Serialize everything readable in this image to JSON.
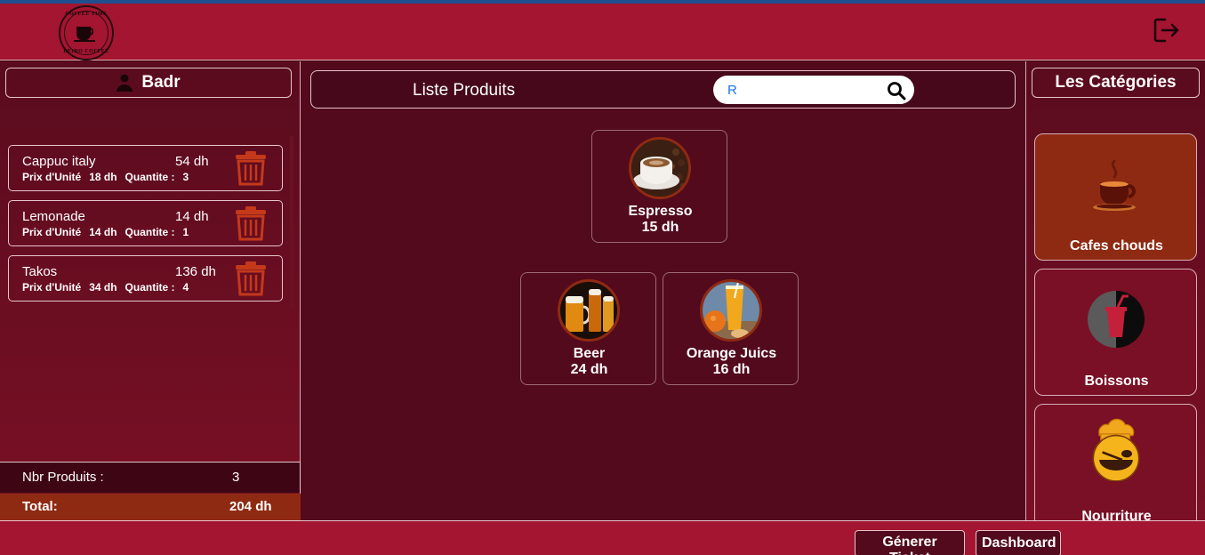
{
  "header": {
    "logo_top_text": "COFFEE TIME",
    "logo_bottom_text": "BEIRO COFFEE",
    "logout_icon": "logout-icon"
  },
  "user": {
    "name": "Badr",
    "icon": "user-icon"
  },
  "cart": {
    "items": [
      {
        "name": "Cappuc italy",
        "total": "54 dh",
        "unit_label": "Prix d'Unité",
        "unit_price": "18 dh",
        "qty_label": "Quantite :",
        "qty": "3"
      },
      {
        "name": "Lemonade",
        "total": "14 dh",
        "unit_label": "Prix d'Unité",
        "unit_price": "14 dh",
        "qty_label": "Quantite :",
        "qty": "1"
      },
      {
        "name": "Takos",
        "total": "136 dh",
        "unit_label": "Prix d'Unité",
        "unit_price": "34 dh",
        "qty_label": "Quantite :",
        "qty": "4"
      }
    ],
    "nbr_label": "Nbr Produits :",
    "nbr_value": "3",
    "total_label": "Total:",
    "total_value": "204 dh"
  },
  "products": {
    "title": "Liste Produits",
    "search_value": "R",
    "items": [
      {
        "name": "Espresso",
        "price": "15 dh"
      },
      {
        "name": "Beer",
        "price": "24 dh"
      },
      {
        "name": "Orange Juics",
        "price": "16 dh"
      }
    ]
  },
  "categories": {
    "title": "Les Catégories",
    "items": [
      {
        "name": "Cafes chouds",
        "active": true
      },
      {
        "name": "Boissons",
        "active": false
      },
      {
        "name": "Nourriture",
        "active": false
      }
    ]
  },
  "footer": {
    "ticket_label": "Génerer Ticket",
    "dashboard_label": "Dashboard"
  },
  "colors": {
    "header": "#a31530",
    "panel": "#520a1c",
    "accent": "#8f2a12",
    "trash": "#c4391a"
  }
}
